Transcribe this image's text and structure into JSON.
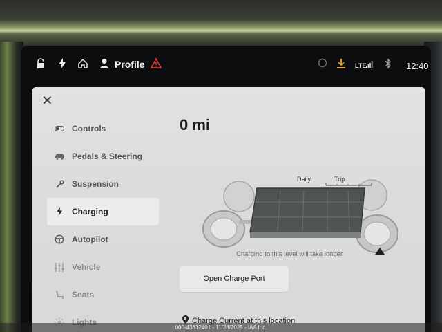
{
  "status_bar": {
    "profile_label": "Profile",
    "network": "LTE",
    "time": "12:40",
    "icons": [
      "lock-icon",
      "bolt-icon",
      "home-icon",
      "person-icon",
      "warning-icon",
      "tire-icon",
      "download-icon",
      "bluetooth-icon"
    ]
  },
  "sidebar": {
    "items": [
      {
        "label": "Controls",
        "icon": "toggle-icon"
      },
      {
        "label": "Pedals & Steering",
        "icon": "car-icon"
      },
      {
        "label": "Suspension",
        "icon": "wrench-icon"
      },
      {
        "label": "Charging",
        "icon": "bolt-icon"
      },
      {
        "label": "Autopilot",
        "icon": "steering-wheel-icon"
      },
      {
        "label": "Vehicle",
        "icon": "sliders-icon"
      },
      {
        "label": "Seats",
        "icon": "seat-icon"
      },
      {
        "label": "Lights",
        "icon": "sun-icon"
      }
    ],
    "active": "Charging"
  },
  "charging": {
    "range": "0 mi",
    "daily_label": "Daily",
    "trip_label": "Trip",
    "hint": "Charging to this level will take longer",
    "open_port_button": "Open Charge Port",
    "location_text": "Charge Current at this location"
  },
  "watermark": "000-43812401 - 11/28/2025 - IAA Inc.",
  "colors": {
    "panel": "#dcdddb",
    "alert": "#e23a3a",
    "download": "#e8a22b"
  }
}
